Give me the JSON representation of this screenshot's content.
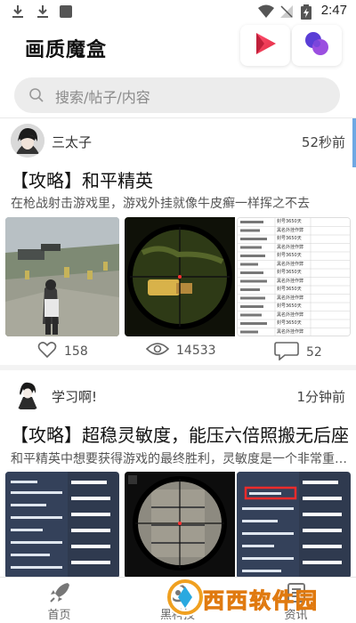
{
  "status_bar": {
    "time": "2:47"
  },
  "header": {
    "app_title": "画质魔盒"
  },
  "search": {
    "placeholder": "搜索/帖子/内容"
  },
  "posts": [
    {
      "author": "三太子",
      "time": "52秒前",
      "title": "【攻略】和平精英",
      "description": "在枪战射击游戏里，游戏外挂就像牛皮癣一样挥之不去",
      "stats": {
        "likes": "158",
        "views": "14533",
        "comments": "52"
      },
      "list_rows": [
        "封号3650天",
        "黑名外挂作弊",
        "封号3650天",
        "黑名外挂作弊",
        "封号3650天",
        "黑名外挂作弊",
        "封号3650天",
        "黑名外挂作弊",
        "封号3650天",
        "黑名外挂作弊",
        "封号3650天",
        "黑名外挂作弊",
        "封号3650天",
        "黑名外挂作弊"
      ]
    },
    {
      "author": "学习啊!",
      "time": "1分钟前",
      "title": "【攻略】超稳灵敏度，能压六倍照搬无后座",
      "description": "和平精英中想要获得游戏的最终胜利，灵敏度是一个非常重要的因素"
    }
  ],
  "bottom_nav": [
    {
      "label": "首页"
    },
    {
      "label": "黑科技"
    },
    {
      "label": "资讯"
    }
  ],
  "watermark": {
    "text": "西西软件园"
  },
  "colors": {
    "accent_red": "#ef3b50",
    "accent_purple": "#7b3fd0",
    "scroll_blue": "#6fa8e3"
  }
}
